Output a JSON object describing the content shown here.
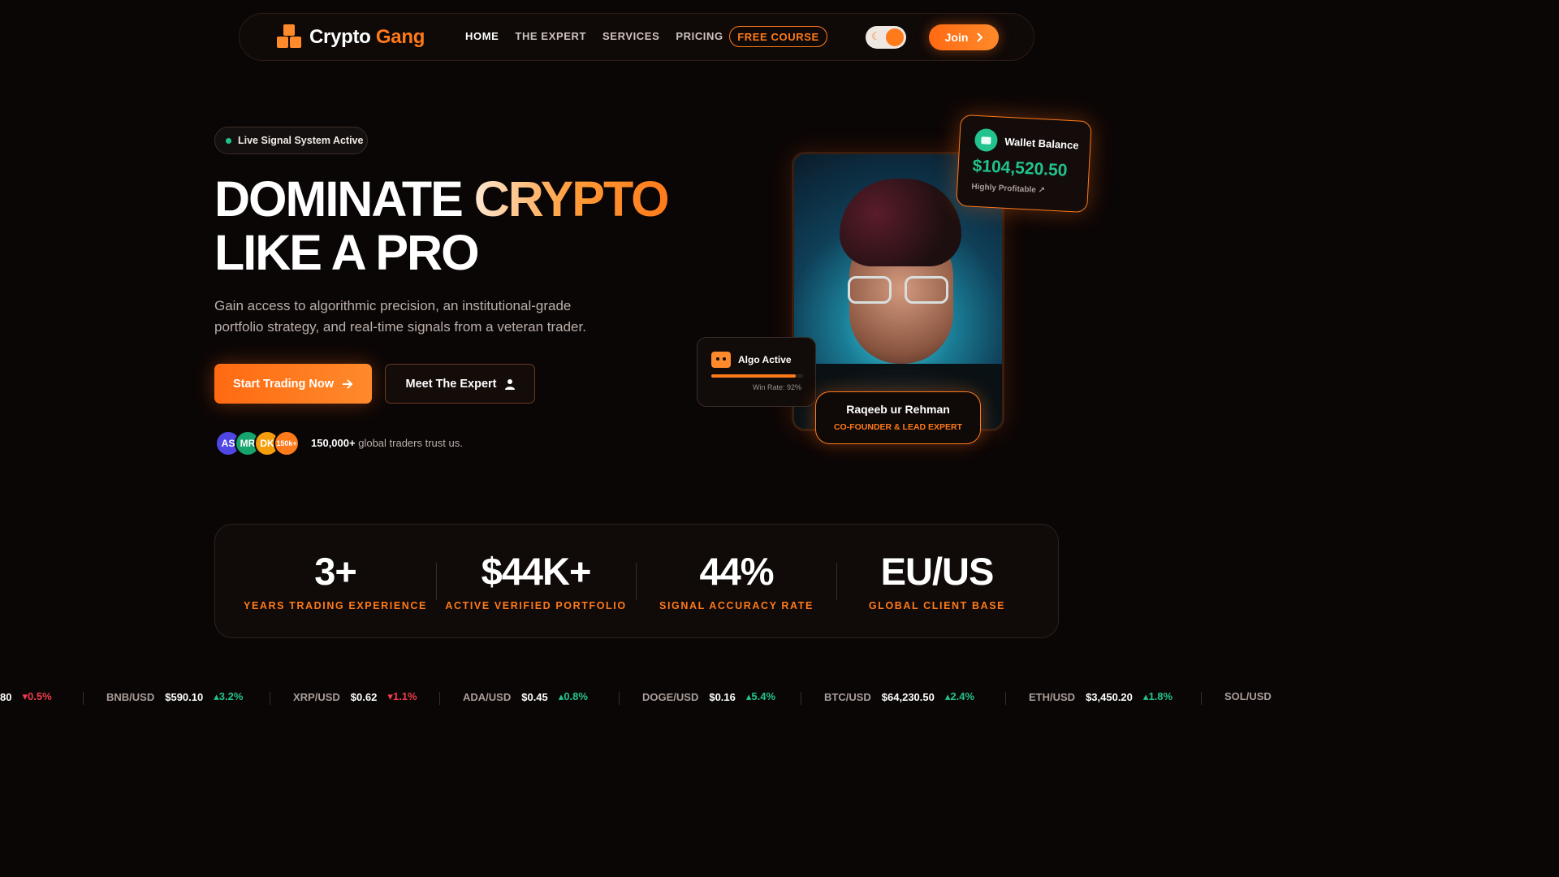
{
  "nav": {
    "logo_first": "Crypto",
    "logo_second": "Gang",
    "links": [
      "HOME",
      "THE EXPERT",
      "SERVICES",
      "PRICING"
    ],
    "free_course": "FREE COURSE",
    "join": "Join"
  },
  "hero": {
    "badge": "Live Signal System Active",
    "title_line1_a": "DOMINATE",
    "title_line1_b": "CRYPTO",
    "title_line2": "LIKE A PRO",
    "subtitle": "Gain access to algorithmic precision, an institutional-grade portfolio strategy, and real-time signals from a veteran trader.",
    "cta_primary": "Start Trading Now",
    "cta_secondary": "Meet The Expert",
    "avatars": [
      "AS",
      "MR",
      "DK",
      "150k+"
    ],
    "trust_count": "150,000+",
    "trust_text": "global traders trust us."
  },
  "wallet": {
    "title": "Wallet Balance",
    "value": "$104,520.50",
    "status": "Highly Profitable"
  },
  "algo": {
    "title": "Algo Active",
    "win_rate_label": "Win Rate: 92%",
    "win_rate": 0.92
  },
  "expert": {
    "name": "Raqeeb ur Rehman",
    "role": "CO-FOUNDER & LEAD EXPERT"
  },
  "stats": [
    {
      "value": "3+",
      "label": "YEARS TRADING EXPERIENCE"
    },
    {
      "value": "$44K+",
      "label": "ACTIVE VERIFIED PORTFOLIO"
    },
    {
      "value": "44%",
      "label": "SIGNAL ACCURACY RATE"
    },
    {
      "value": "EU/US",
      "label": "GLOBAL CLIENT BASE"
    }
  ],
  "ticker": [
    {
      "symbol": "",
      "price": "80",
      "change": "0.5%",
      "dir": "down"
    },
    {
      "symbol": "BNB/USD",
      "price": "$590.10",
      "change": "3.2%",
      "dir": "up"
    },
    {
      "symbol": "XRP/USD",
      "price": "$0.62",
      "change": "1.1%",
      "dir": "down"
    },
    {
      "symbol": "ADA/USD",
      "price": "$0.45",
      "change": "0.8%",
      "dir": "up"
    },
    {
      "symbol": "DOGE/USD",
      "price": "$0.16",
      "change": "5.4%",
      "dir": "up"
    },
    {
      "symbol": "BTC/USD",
      "price": "$64,230.50",
      "change": "2.4%",
      "dir": "up"
    },
    {
      "symbol": "ETH/USD",
      "price": "$3,450.20",
      "change": "1.8%",
      "dir": "up"
    },
    {
      "symbol": "SOL/USD",
      "price": "",
      "change": "",
      "dir": "up"
    }
  ],
  "colors": {
    "accent": "#ff7a1a",
    "up": "#22c38e",
    "down": "#ef3d4a",
    "background": "#0b0606"
  },
  "icons": [
    "logo-cubes-icon",
    "moon-icon",
    "chevron-right-icon",
    "arrow-right-icon",
    "user-icon",
    "wallet-icon",
    "trend-up-icon",
    "robot-icon",
    "caret-up-icon",
    "caret-down-icon"
  ]
}
